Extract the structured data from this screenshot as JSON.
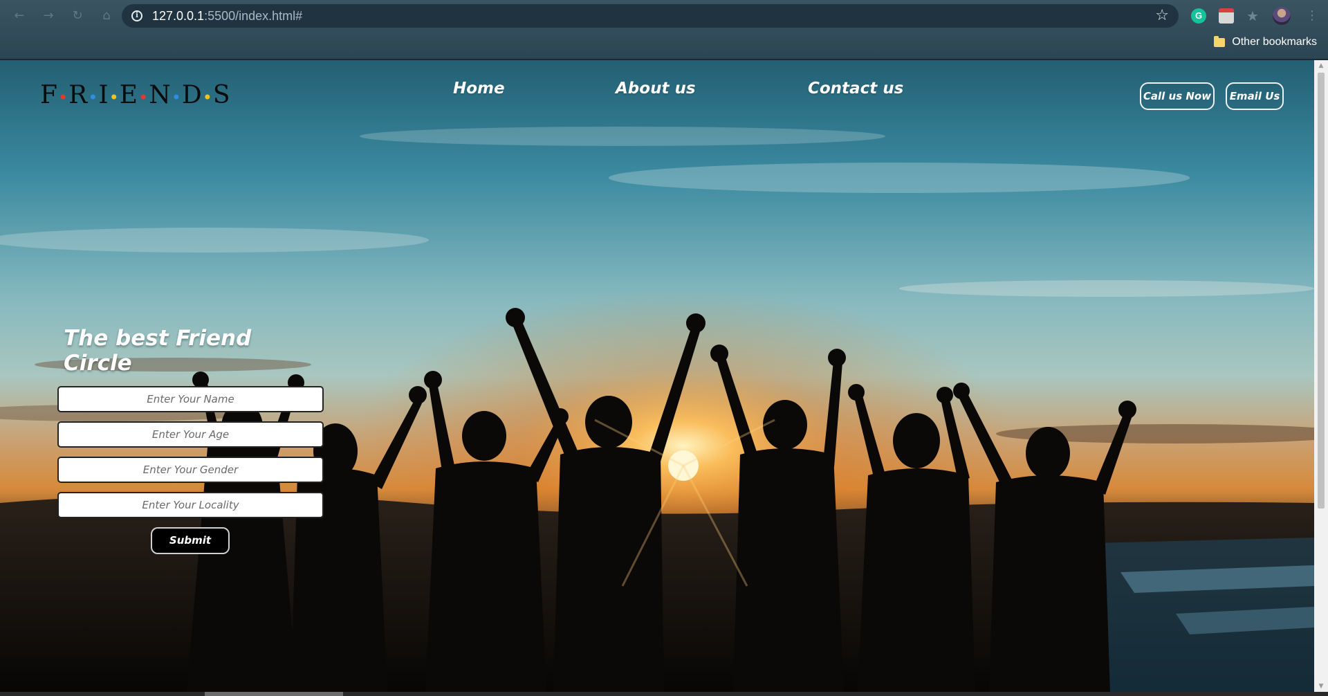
{
  "browser": {
    "url_host": "127.0.0.1",
    "url_rest": ":5500/index.html#",
    "bookmark_folder": "Other bookmarks",
    "nav": [
      "back",
      "forward",
      "reload",
      "home"
    ],
    "extension_grammarly_letter": "G"
  },
  "site": {
    "logo": {
      "letters": [
        "F",
        "R",
        "I",
        "E",
        "N",
        "D",
        "S"
      ],
      "dot_colors": [
        "#e03b2f",
        "#2f8ee0",
        "#f4c21b",
        "#e03b2f",
        "#2f8ee0",
        "#f4c21b"
      ]
    },
    "nav": {
      "home": "Home",
      "about": "About us",
      "contact": "Contact us"
    },
    "actions": {
      "call": "Call us Now",
      "email": "Email Us"
    }
  },
  "hero": {
    "title": "The best Friend Circle",
    "fields": {
      "name_placeholder": "Enter Your Name",
      "age_placeholder": "Enter Your Age",
      "gender_placeholder": "Enter Your Gender",
      "locality_placeholder": "Enter Your Locality"
    },
    "submit_label": "Submit"
  },
  "colors": {
    "sky_top": "#2b7a8f",
    "sky_mid": "#8fbcbe",
    "sun": "#ffd37a",
    "silhouette": "#0b0907"
  }
}
